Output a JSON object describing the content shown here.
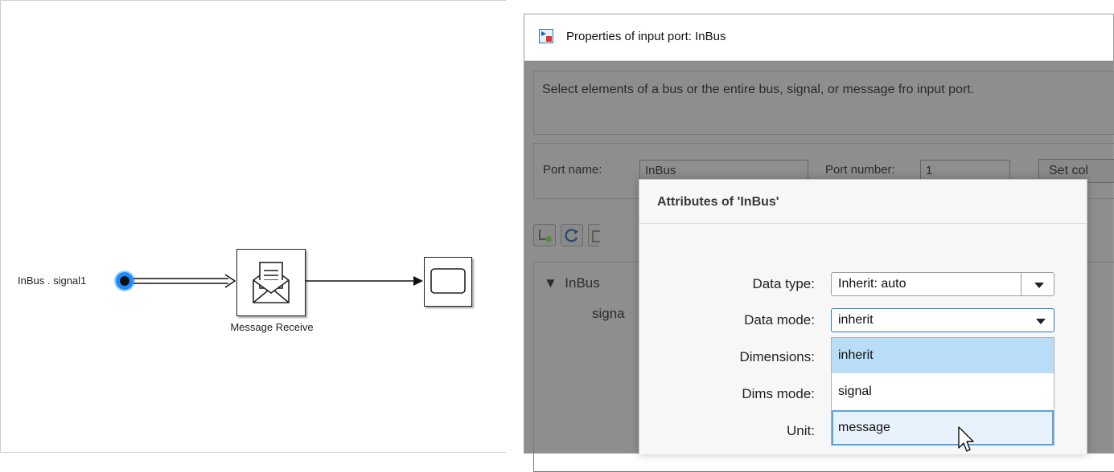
{
  "canvas": {
    "signal_label": "InBus . signal1",
    "block_label": "Message Receive"
  },
  "dialog": {
    "title": "Properties of input port: InBus",
    "description": "Select elements of a bus or the entire bus, signal, or message fro input port.",
    "port_name_label": "Port name:",
    "port_name_value": "InBus",
    "port_number_label": "Port number:",
    "port_number_value": "1",
    "set_button_label": "Set col",
    "tree": {
      "root": "InBus",
      "child": "signa"
    }
  },
  "attributes": {
    "title": "Attributes of 'InBus'",
    "fields": [
      {
        "label": "Data type:",
        "value": "Inherit: auto"
      },
      {
        "label": "Data mode:",
        "value": "inherit"
      },
      {
        "label": "Dimensions:"
      },
      {
        "label": "Dims mode:"
      },
      {
        "label": "Unit:"
      }
    ],
    "dropdown_options": [
      "inherit",
      "signal",
      "message"
    ],
    "selected_option": "inherit",
    "hovered_option": "message"
  },
  "colors": {
    "selection_blue": "#1a8cff",
    "overlay_gray": "#8e8e8e",
    "option_selected": "#b9dcf7",
    "option_hover_border": "#5aa3e0"
  }
}
